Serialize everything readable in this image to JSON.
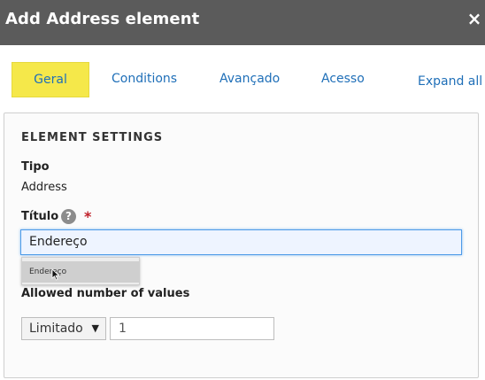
{
  "dialog": {
    "title": "Add Address element",
    "close_glyph": "×"
  },
  "tabs": {
    "geral": "Geral",
    "conditions": "Conditions",
    "avancado": "Avançado",
    "acesso": "Acesso",
    "expand_all": "Expand all",
    "active_color": "#f5e84a",
    "link_color": "#1f6fb8"
  },
  "settings": {
    "section_title": "ELEMENT SETTINGS",
    "tipo_label": "Tipo",
    "tipo_value": "Address",
    "titulo_label": "Título",
    "help_glyph": "?",
    "required_mark": "*",
    "titulo_value": "Endereço",
    "autocomplete_option": "Endereço",
    "allowed_label": "Allowed number of values",
    "limit_select": "Limitado",
    "select_arrow": "▼",
    "limit_number": "1"
  }
}
